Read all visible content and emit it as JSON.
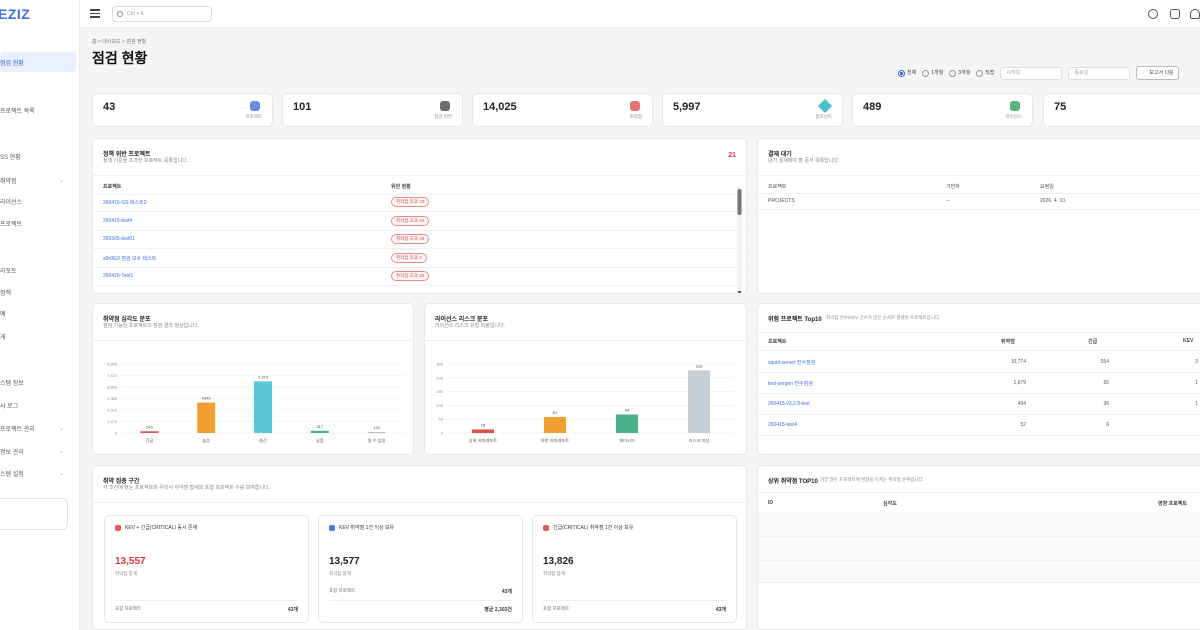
{
  "app": {
    "logo": "EZIZ"
  },
  "sidebar": {
    "items": [
      {
        "label": "점검 현황",
        "active": true
      },
      {
        "label": "프로젝트 목록"
      },
      {
        "label": "SS 현황"
      },
      {
        "label": "취약점",
        "chevron": "⌄"
      },
      {
        "label": "라이선스"
      },
      {
        "label": "프로젝트"
      },
      {
        "label": "리포트"
      },
      {
        "label": "정책"
      },
      {
        "label": "예"
      },
      {
        "label": "게"
      },
      {
        "label": "스템 정보"
      },
      {
        "label": "사 로그"
      },
      {
        "label": "프로젝트 관리",
        "chevron": "⌄"
      },
      {
        "label": "정보 관리",
        "chevron": "⌄"
      },
      {
        "label": "스템 설정",
        "chevron": "⌄"
      }
    ]
  },
  "topbar": {
    "search_placeholder": "Ctrl + K"
  },
  "breadcrumb": "홈  >  대시보드  >  점검 현황",
  "page_title": "점검 현황",
  "filters": {
    "options": [
      "전체",
      "1개월",
      "3개월",
      "직접"
    ],
    "selected": "전체",
    "start_placeholder": "시작일",
    "end_placeholder": "종료일",
    "report_label": "보고서 다운"
  },
  "stats": [
    {
      "value": "43",
      "label": "프로젝트",
      "icon": "cube-icon",
      "color": "#4a7be0"
    },
    {
      "value": "101",
      "label": "점검 버전",
      "icon": "scan-icon",
      "color": "#555555"
    },
    {
      "value": "14,025",
      "label": "취약점",
      "icon": "bug-icon",
      "color": "#e0585b"
    },
    {
      "value": "5,997",
      "label": "컴포넌트",
      "icon": "diamond-icon",
      "color": "#2bb5c9"
    },
    {
      "value": "489",
      "label": "라이선스",
      "icon": "book-icon",
      "color": "#3aa866"
    },
    {
      "value": "75",
      "label": "KEV",
      "icon": "warning-icon",
      "color": "#555555"
    }
  ],
  "policy_card": {
    "title": "정책 위반 프로젝트",
    "subtitle": "정책 기준을 초과한 프로젝트 목록입니다.",
    "count": "21",
    "col_project": "프로젝트",
    "col_status": "위반 현황",
    "rows": [
      {
        "project": "260416-GS 테스트2",
        "status": "취약점 초과 20"
      },
      {
        "project": "260415-test4",
        "status": "취약점 초과 32"
      },
      {
        "project": "260305-test01",
        "status": "취약점 초과 20"
      },
      {
        "project": "a9r0ED 점검 보수 테스트",
        "status": "취약점 초과 4"
      },
      {
        "project": "260420-Test1",
        "status": "취약점 초과 20"
      }
    ]
  },
  "approval_card": {
    "title": "결재 대기",
    "subtitle": "내가 결재해야 할 문서 목록입니다.",
    "col_project": "프로젝트",
    "col_requester": "기안자",
    "col_date": "요청일",
    "row": {
      "project": "PROJECTS",
      "requester": "--",
      "date": "2026. 4. 10."
    }
  },
  "severity_chart": {
    "title": "취약점 심각도 분포",
    "subtitle": "점검 가능한 프로젝트의 점검 결과 정상입니다."
  },
  "license_chart": {
    "title": "라이선스 리스크 분포",
    "subtitle": "라이선스 리스크 유형 비율입니다."
  },
  "chart_data": [
    {
      "type": "bar",
      "categories": [
        "긴급",
        "높음",
        "중간",
        "낮음",
        "알 수 없음"
      ],
      "values": [
        245,
        4345,
        7373,
        317,
        142
      ],
      "value_labels": [
        "245",
        "4345",
        "7,373",
        "317",
        "142"
      ],
      "y_ticks": [
        "0",
        "1,670",
        "3,310",
        "4,960",
        "6,600",
        "7,870",
        "9,845"
      ],
      "ylim": [
        0,
        9845
      ],
      "colors": [
        "#d9534f",
        "#f0a030",
        "#5bc8d8",
        "#4cb08a",
        "#b8c0c8"
      ]
    },
    {
      "type": "bar",
      "categories": [
        "상위 카피레프트",
        "약한 카피레프트",
        "퍼미시브",
        "리스크 미상"
      ],
      "values": [
        18,
        81,
        94,
        318
      ],
      "value_labels": [
        "18",
        "81",
        "94",
        "318"
      ],
      "y_ticks": [
        "0",
        "50",
        "100",
        "150",
        "200",
        "300"
      ],
      "ylim": [
        0,
        350
      ],
      "colors": [
        "#d9534f",
        "#f0a030",
        "#4cb08a",
        "#c8ced6"
      ]
    }
  ],
  "top10_card": {
    "title": "위험 프로젝트 Top10",
    "subtitle": "취약점 건수/KEV 건수가 많은 순서로 정렬된 프로젝트입니다.",
    "col_project": "프로젝트",
    "col_vuln": "취약점",
    "col_critical": "긴급",
    "col_kev": "KEV",
    "rows": [
      {
        "project": "squid-server 전수점검",
        "vuln": "10,774",
        "critical": "554",
        "kev": "3"
      },
      {
        "project": "test-sergen 전수점검",
        "vuln": "1,679",
        "critical": "55",
        "kev": "1"
      },
      {
        "project": "260415-v3.2.8-test",
        "vuln": "494",
        "critical": "36",
        "kev": "1"
      },
      {
        "project": "260415-test4",
        "vuln": "52",
        "critical": "6",
        "kev": ""
      }
    ]
  },
  "concentration_card": {
    "title": "취약 집중 구간",
    "subtitle": "각 조건에 맞는 프로젝트와 우리서 취약점 합계와 포함 프로젝트 수를 보여줍니다.",
    "items": [
      {
        "label": "KEV + 긴급(CRITICAL) 동시 존재",
        "value": "13,557",
        "value_color": "#d9363e",
        "count_label": "취약점 합계",
        "foot_label": "포함 프로젝트",
        "foot_value": "43개",
        "icon_color": "#e0585b"
      },
      {
        "label": "KEV 취약점 1건 이상 보유",
        "value": "13,577",
        "value_color": "#222222",
        "count_label": "취약점 합계",
        "foot_label": "포함 프로젝트",
        "foot_value": "43개",
        "extra_value": "평균 2,303건",
        "icon_color": "#4a7be0"
      },
      {
        "label": "긴급(CRITICAL) 취약점 1건 이상 보유",
        "value": "13,826",
        "value_color": "#222222",
        "count_label": "취약점 합계",
        "foot_label": "포함 프로젝트",
        "foot_value": "43개",
        "icon_color": "#e0585b"
      }
    ]
  },
  "top_vuln_card": {
    "title": "상위 취약점 TOP10",
    "subtitle": "가장 많은 프로젝트에 영향을 미치는 취약점 순위입니다.",
    "col_id": "ID",
    "col_severity": "심각도",
    "col_impact": "영향 프로젝트"
  }
}
